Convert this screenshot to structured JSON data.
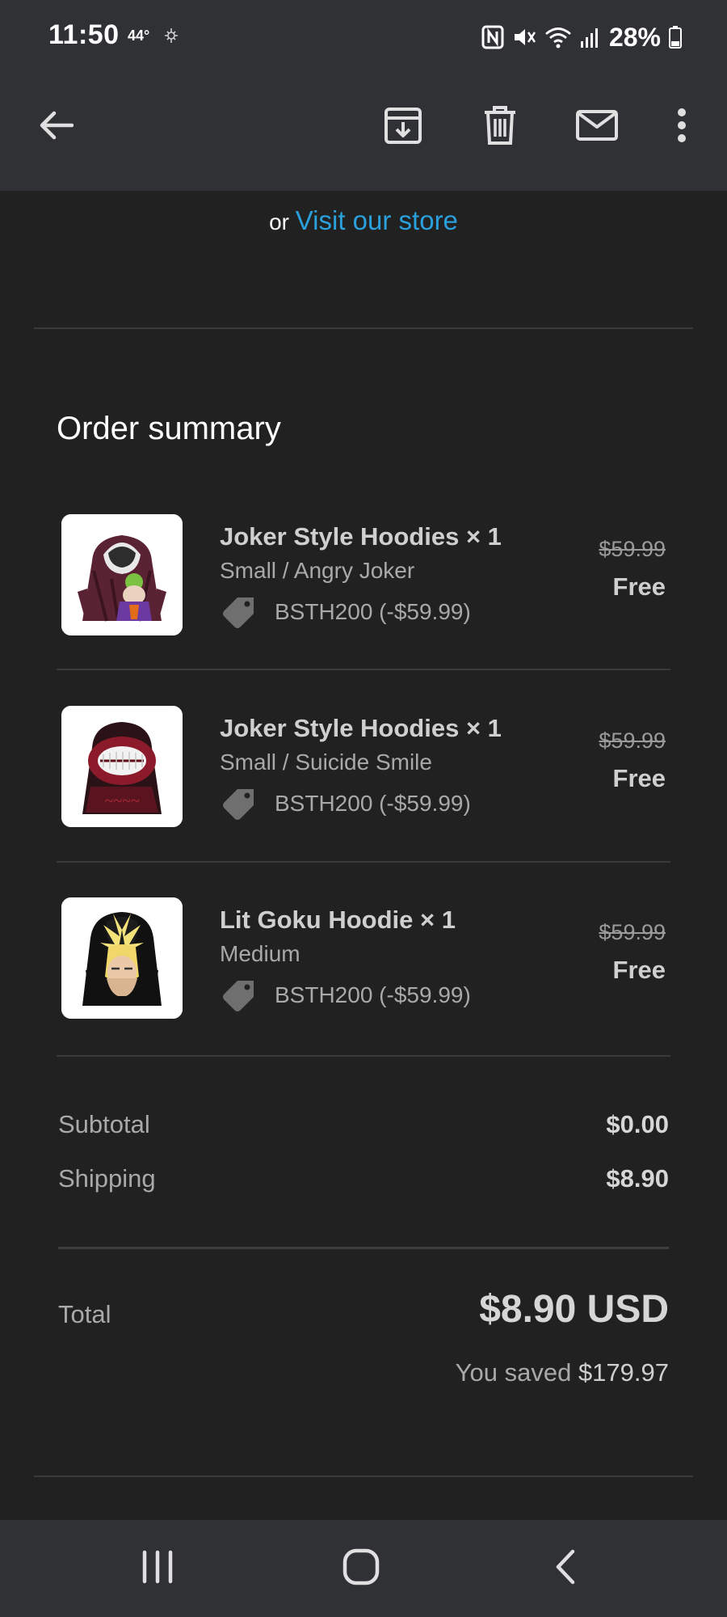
{
  "status_bar": {
    "time": "11:50",
    "temperature": "44°",
    "battery": "28%",
    "icons": [
      "weather-icon",
      "nfc-icon",
      "mute-icon",
      "wifi-icon",
      "signal-icon",
      "battery-icon"
    ]
  },
  "app_bar": {
    "icons": [
      "back-arrow-icon",
      "archive-icon",
      "delete-icon",
      "mark-unread-icon",
      "more-vert-icon"
    ]
  },
  "email": {
    "store_prefix": "or",
    "store_link": "Visit our store",
    "order_summary": {
      "title": "Order summary",
      "items": [
        {
          "name": "Joker Style Hoodies × 1",
          "variant": "Small / Angry Joker",
          "discount": "BSTH200 (-$59.99)",
          "original_price": "$59.99",
          "price": "Free"
        },
        {
          "name": "Joker Style Hoodies × 1",
          "variant": "Small / Suicide Smile",
          "discount": "BSTH200 (-$59.99)",
          "original_price": "$59.99",
          "price": "Free"
        },
        {
          "name": "Lit Goku Hoodie × 1",
          "variant": "Medium",
          "discount": "BSTH200 (-$59.99)",
          "original_price": "$59.99",
          "price": "Free"
        }
      ],
      "subtotal_label": "Subtotal",
      "subtotal_value": "$0.00",
      "shipping_label": "Shipping",
      "shipping_value": "$8.90",
      "total_label": "Total",
      "total_value": "$8.90 USD",
      "saved_prefix": "You saved",
      "saved_amount": "$179.97"
    }
  },
  "nav_bar": {
    "icons": [
      "recent-apps-icon",
      "home-icon",
      "back-icon"
    ]
  },
  "colors": {
    "background": "#212121",
    "top_bar": "#2f3135",
    "link": "#2aa0dc"
  }
}
